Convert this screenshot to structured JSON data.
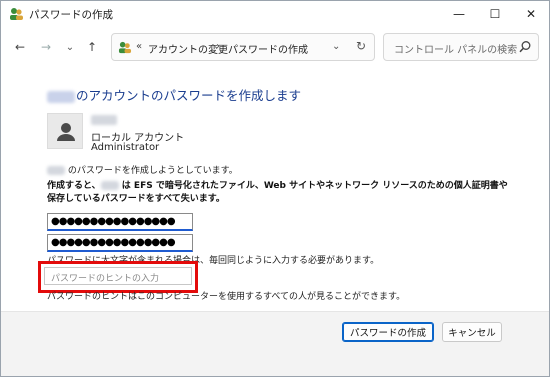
{
  "window": {
    "title": "パスワードの作成",
    "controls": {
      "minimize": "—",
      "maximize": "☐",
      "close": "✕"
    }
  },
  "navigation": {
    "back_icon": "arrow-left-icon",
    "forward_icon": "arrow-right-icon",
    "recent_icon": "chevron-down-icon",
    "up_icon": "arrow-up-icon",
    "glyphs": {
      "back": "←",
      "forward": "→",
      "recent": "⌄",
      "up": "↑",
      "refresh": "↻",
      "crumb_sep": "›",
      "overflow": "«",
      "dropdown": "⌄"
    }
  },
  "address_bar": {
    "breadcrumb": [
      "アカウントの変更",
      "パスワードの作成"
    ]
  },
  "search": {
    "placeholder": "コントロール パネルの検索"
  },
  "content": {
    "heading_suffix": "のアカウントのパスワードを作成します",
    "account": {
      "type": "ローカル アカウント",
      "role": "Administrator"
    },
    "info_suffix": "のパスワードを作成しようとしています。",
    "warning_prefix": "作成すると、",
    "warning_suffix": "は EFS で暗号化されたファイル、Web サイトやネットワーク リソースのための個人証明書や保存しているパスワードをすべて失います。",
    "password_mask": "●●●●●●●●●●●●●●●●",
    "confirm_mask": "●●●●●●●●●●●●●●●●",
    "caps_note": "パスワードに大文字が含まれる場合は、毎回同じように入力する必要があります。",
    "hint_placeholder": "パスワードのヒントの入力",
    "hint_note": "パスワードのヒントはこのコンピューターを使用するすべての人が見ることができます。"
  },
  "buttons": {
    "create": "パスワードの作成",
    "cancel": "キャンセル"
  },
  "colors": {
    "heading": "#1a3d8f",
    "highlight": "#e30b0b",
    "focus_underline": "#1f5bd0",
    "primary_border": "#0a64c8"
  }
}
